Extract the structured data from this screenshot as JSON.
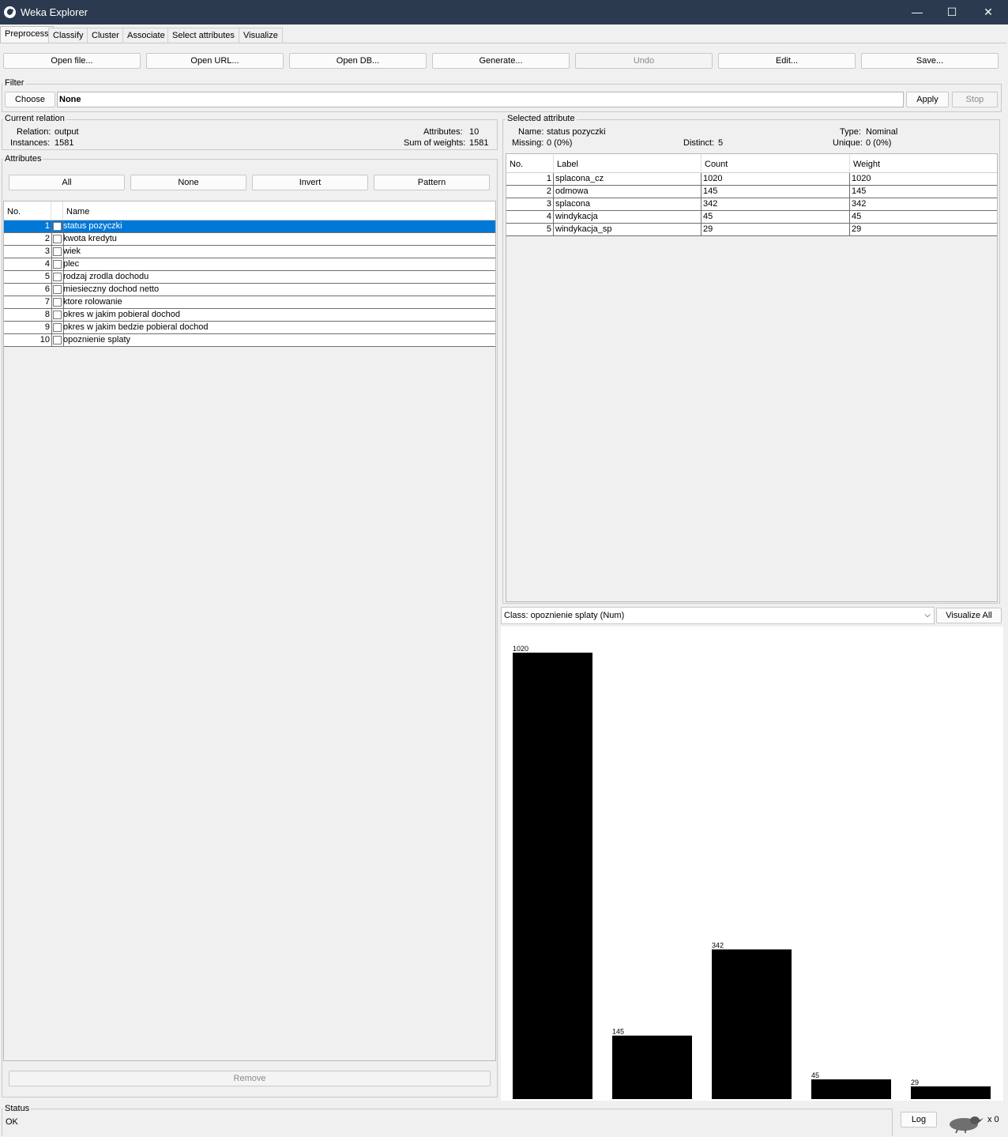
{
  "window": {
    "title": "Weka Explorer",
    "minimize": "—",
    "maximize": "☐",
    "close": "✕"
  },
  "tabs": [
    "Preprocess",
    "Classify",
    "Cluster",
    "Associate",
    "Select attributes",
    "Visualize"
  ],
  "toolbar": {
    "open_file": "Open file...",
    "open_url": "Open URL...",
    "open_db": "Open DB...",
    "generate": "Generate...",
    "undo": "Undo",
    "edit": "Edit...",
    "save": "Save..."
  },
  "filter": {
    "label": "Filter",
    "choose": "Choose",
    "value": "None",
    "apply": "Apply",
    "stop": "Stop"
  },
  "current_relation": {
    "label": "Current relation",
    "relation_label": "Relation:",
    "relation": "output",
    "instances_label": "Instances:",
    "instances": "1581",
    "attributes_label": "Attributes:",
    "attributes": "10",
    "sum_weights_label": "Sum of weights:",
    "sum_weights": "1581"
  },
  "attributes": {
    "label": "Attributes",
    "all": "All",
    "none": "None",
    "invert": "Invert",
    "pattern": "Pattern",
    "col_no": "No.",
    "col_name": "Name",
    "rows": [
      {
        "no": "1",
        "name": "status pozyczki"
      },
      {
        "no": "2",
        "name": "kwota kredytu"
      },
      {
        "no": "3",
        "name": "wiek"
      },
      {
        "no": "4",
        "name": "plec"
      },
      {
        "no": "5",
        "name": "rodzaj zrodla dochodu"
      },
      {
        "no": "6",
        "name": "miesieczny dochod netto"
      },
      {
        "no": "7",
        "name": "ktore rolowanie"
      },
      {
        "no": "8",
        "name": "okres w jakim pobieral dochod"
      },
      {
        "no": "9",
        "name": "okres w jakim bedzie pobieral dochod"
      },
      {
        "no": "10",
        "name": "opoznienie splaty"
      }
    ],
    "selected_index": 0,
    "remove": "Remove"
  },
  "selected_attribute": {
    "label": "Selected attribute",
    "name_label": "Name:",
    "name": "status pozyczki",
    "missing_label": "Missing:",
    "missing": "0 (0%)",
    "distinct_label": "Distinct:",
    "distinct": "5",
    "type_label": "Type:",
    "type": "Nominal",
    "unique_label": "Unique:",
    "unique": "0 (0%)",
    "col_no": "No.",
    "col_label": "Label",
    "col_count": "Count",
    "col_weight": "Weight",
    "rows": [
      {
        "no": "1",
        "label": "splacona_cz",
        "count": "1020",
        "weight": "1020"
      },
      {
        "no": "2",
        "label": "odmowa",
        "count": "145",
        "weight": "145"
      },
      {
        "no": "3",
        "label": "splacona",
        "count": "342",
        "weight": "342"
      },
      {
        "no": "4",
        "label": "windykacja",
        "count": "45",
        "weight": "45"
      },
      {
        "no": "5",
        "label": "windykacja_sp",
        "count": "29",
        "weight": "29"
      }
    ]
  },
  "class_select": {
    "value": "Class: opoznienie splaty (Num)",
    "visualize_all": "Visualize All"
  },
  "chart_data": {
    "type": "bar",
    "categories": [
      "splacona_cz",
      "odmowa",
      "splacona",
      "windykacja",
      "windykacja_sp"
    ],
    "values": [
      1020,
      145,
      342,
      45,
      29
    ],
    "data_labels": [
      "1020",
      "145",
      "342",
      "45",
      "29"
    ],
    "bar_color": "#000000",
    "background": "#ffffff",
    "title": "",
    "xlabel": "",
    "ylabel": "",
    "ylim": [
      0,
      1020
    ]
  },
  "status": {
    "label": "Status",
    "text": "OK",
    "log": "Log",
    "count": "x 0"
  }
}
